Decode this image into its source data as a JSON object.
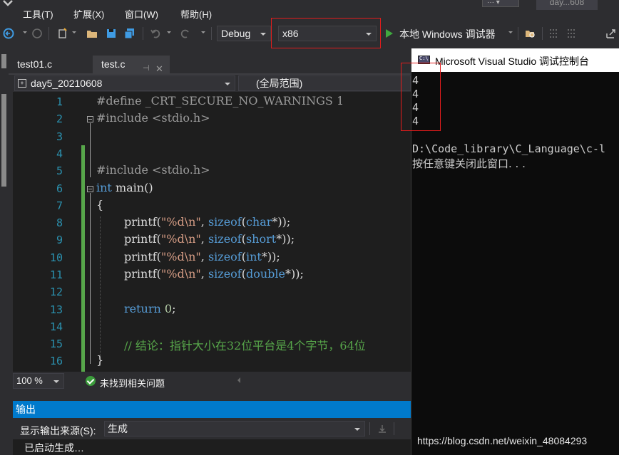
{
  "menu": {
    "items": [
      "工具(T)",
      "扩展(X)",
      "窗口(W)",
      "帮助(H)"
    ]
  },
  "title_stub": "day...608",
  "toolbar": {
    "config_value": "Debug",
    "platform_value": "x86",
    "run_label": "本地 Windows 调试器"
  },
  "tabs": [
    {
      "label": "test01.c"
    },
    {
      "label": "test.c"
    }
  ],
  "navbar": {
    "project": "day5_20210608",
    "scope": "(全局范围)"
  },
  "editor": {
    "lines": [
      {
        "n": "1"
      },
      {
        "n": "2"
      },
      {
        "n": "3"
      },
      {
        "n": "4"
      },
      {
        "n": "5"
      },
      {
        "n": "6"
      },
      {
        "n": "7"
      },
      {
        "n": "8"
      },
      {
        "n": "9"
      },
      {
        "n": "10"
      },
      {
        "n": "11"
      },
      {
        "n": "12"
      },
      {
        "n": "13"
      },
      {
        "n": "14"
      },
      {
        "n": "15"
      },
      {
        "n": "16"
      }
    ],
    "code": {
      "l1_dir": "#define",
      "l1_rest": " _CRT_SECURE_NO_WARNINGS 1",
      "l2_dir": "#include",
      "l2_rest": " <stdio.h>",
      "l5_dir": "#include",
      "l5_rest": " <stdio.h>",
      "l6_kw": "int",
      "l6_rest": " main()",
      "l7": "{",
      "printf": "printf(",
      "fmt": "\"%d\\n\"",
      "sizeof": "sizeof",
      "l8_type": "char",
      "l9_type": "short",
      "l10_type": "int",
      "l11_type": "double",
      "ptr_close": "*));",
      "comma": ", ",
      "paren": "(",
      "l13_kw": "return",
      "l13_num": "0",
      "l13_end": ";",
      "l15": "// 结论：指针大小在32位平台是4个字节，64位",
      "l16": "}"
    }
  },
  "status": {
    "zoom": "100 %",
    "issues": "未找到相关问题"
  },
  "output": {
    "title": "输出",
    "source_label": "显示输出来源(S):",
    "source_value": "生成",
    "line": "已启动生成…"
  },
  "console": {
    "title": "Microsoft Visual Studio 调试控制台",
    "values": [
      "4",
      "4",
      "4",
      "4"
    ],
    "path": "D:\\Code_library\\C_Language\\c-l",
    "prompt": "按任意键关闭此窗口. . ."
  },
  "watermark": "https://blog.csdn.net/weixin_48084293",
  "colors": {
    "accent": "#007acc",
    "highlight_box": "#e31c1c",
    "line_numbers": "#2b91af"
  }
}
